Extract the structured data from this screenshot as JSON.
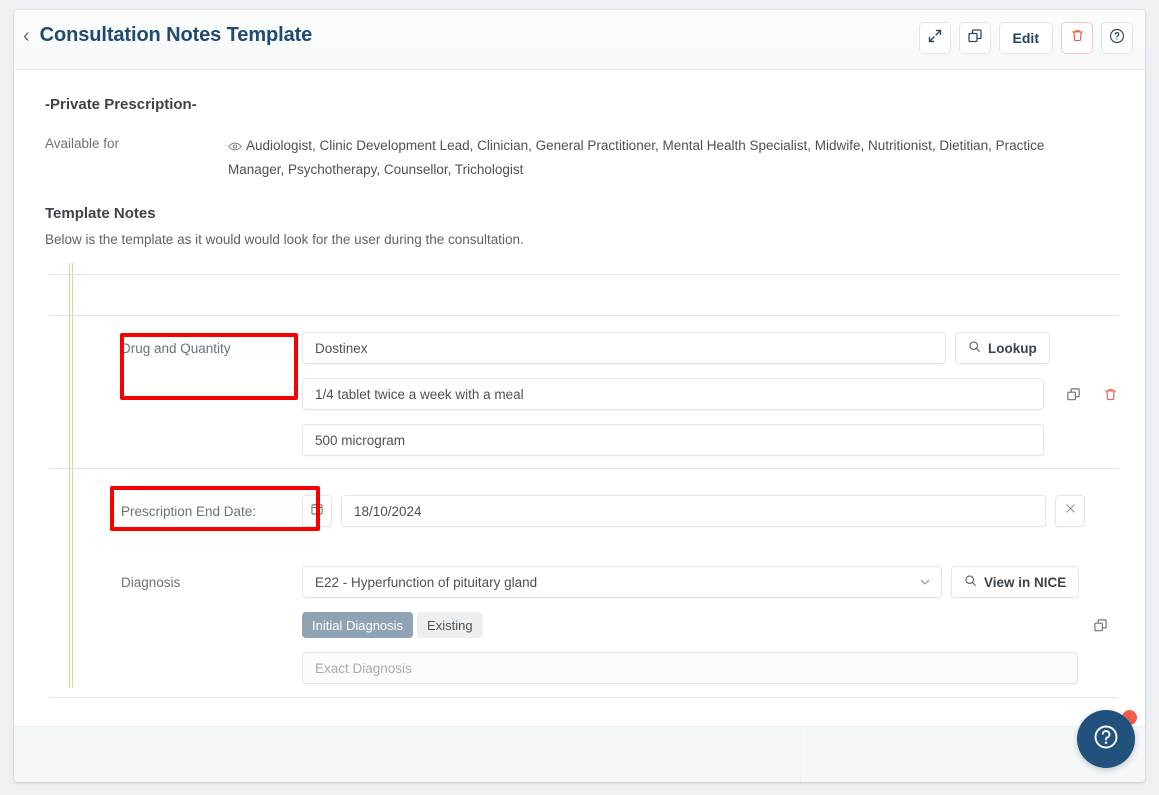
{
  "header": {
    "back_icon": "chevron-left-icon",
    "title": "Consultation Notes Template",
    "actions": [
      {
        "name": "expand-button",
        "icon": "expand-arrows-icon",
        "label": ""
      },
      {
        "name": "duplicate-button",
        "icon": "copy-icon",
        "label": ""
      },
      {
        "name": "edit-button",
        "icon": "",
        "label": "Edit"
      },
      {
        "name": "delete-button",
        "icon": "trash-icon",
        "label": ""
      },
      {
        "name": "help-button",
        "icon": "question-circle-icon",
        "label": ""
      }
    ]
  },
  "content": {
    "private_title": "-Private Prescription-",
    "available_for_label": "Available for",
    "available_for_icon": "eye-icon",
    "available_for_values": "Audiologist,  Clinic Development Lead,  Clinician,  General Practitioner,  Mental Health Specialist,  Midwife,  Nutritionist, Dietitian,  Practice Manager,  Psychotherapy, Counsellor,  Trichologist",
    "template_notes_title": "Template Notes",
    "template_notes_sub": "Below is the template as it would would look for the user during the consultation."
  },
  "form": {
    "drug": {
      "label": "Drug and Quantity",
      "name_value": "Dostinex",
      "dose_value": "1/4 tablet twice a week with a meal",
      "strength_value": "500 microgram",
      "lookup_label": "Lookup",
      "lookup_icon": "search-icon",
      "copy_icon": "copy-icon",
      "delete_icon": "trash-icon",
      "highlighted": true
    },
    "prescription_end_date": {
      "label": "Prescription End Date:",
      "calendar_icon": "calendar-icon",
      "value": "18/10/2024",
      "clear_icon": "close-icon",
      "highlighted": true
    },
    "diagnosis": {
      "label": "Diagnosis",
      "selected": "E22 - Hyperfunction of pituitary gland",
      "chevron_icon": "chevron-down-icon",
      "nice_label": "View in NICE",
      "nice_icon": "search-icon",
      "segments": [
        {
          "label": "Initial Diagnosis",
          "active": true
        },
        {
          "label": "Existing",
          "active": false
        }
      ],
      "copy_icon": "copy-icon",
      "exact_placeholder": "Exact Diagnosis"
    }
  },
  "fab": {
    "icon": "question-circle-icon",
    "badge": true
  },
  "colors": {
    "title": "#214a72",
    "annotation": "#f70000",
    "danger": "#e8604c",
    "segment_active_bg": "#8fa3b5",
    "fab_bg": "#21517c",
    "fab_badge": "#f25c4a",
    "guide_line": "#e3cf9c"
  }
}
